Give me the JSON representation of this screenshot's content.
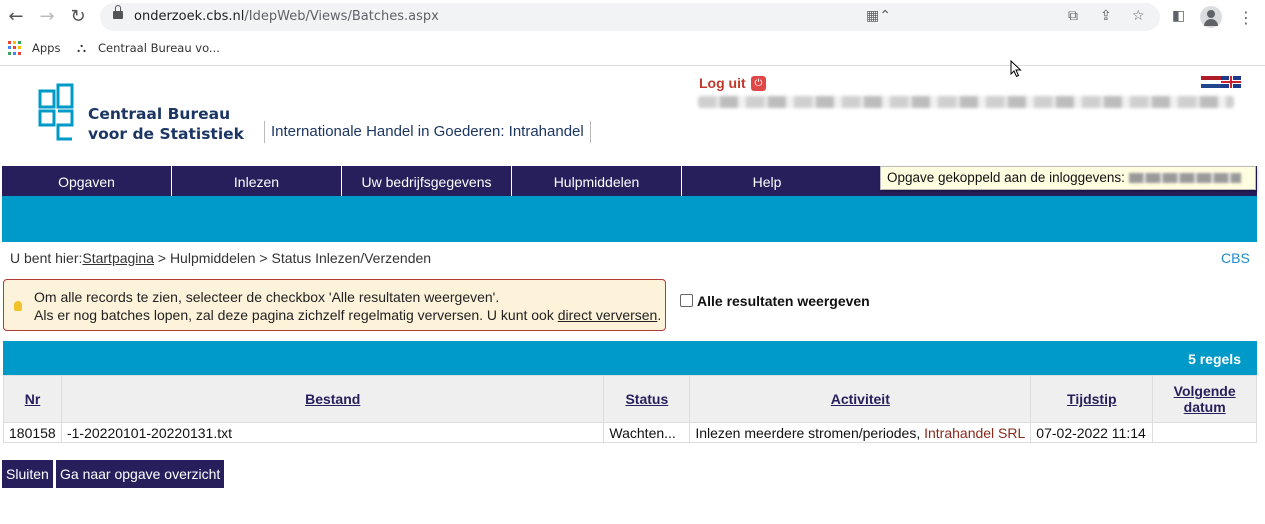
{
  "browser": {
    "url_host": "onderzoek.cbs.nl",
    "url_path": "/IdepWeb/Views/Batches.aspx",
    "bookmarks": [
      "Apps",
      "Centraal Bureau vo..."
    ]
  },
  "header": {
    "logo_line1": "Centraal Bureau",
    "logo_line2": "voor de Statistiek",
    "app_title": "Internationale Handel in Goederen: Intrahandel",
    "logout": "Log uit"
  },
  "menu": {
    "items": [
      "Opgaven",
      "Inlezen",
      "Uw bedrijfsgegevens",
      "Hulpmiddelen",
      "Help"
    ],
    "tooltip": "Opgave gekoppeld aan de inloggevens:"
  },
  "breadcrumb": {
    "prefix": "U bent hier:",
    "home": "Startpagina",
    "sep1": " > Hulpmiddelen > Status Inlezen/Verzenden",
    "cbs": "CBS"
  },
  "notice": {
    "line1": "Om alle records te zien, selecteer de checkbox 'Alle resultaten weergeven'.",
    "line2_pre": "Als er nog batches lopen, zal deze pagina zichzelf regelmatig verversen. U kunt ook ",
    "line2_link": "direct verversen",
    "line2_post": "."
  },
  "filter": {
    "label": "Alle resultaten weergeven",
    "checked": false
  },
  "table": {
    "count_label": "5 regels",
    "headers": {
      "nr": "Nr",
      "bestand": "Bestand",
      "status": "Status",
      "activiteit": "Activiteit",
      "tijdstip": "Tijdstip",
      "volgende": "Volgende datum"
    },
    "rows": [
      {
        "nr": "180158",
        "bestand": "-1-20220101-20220131.txt",
        "status": "Wachten...",
        "activiteit": "Inlezen meerdere stromen/periodes,",
        "product": "Intrahandel SRL",
        "tijdstip": "07-02-2022 11:14",
        "volgende": ""
      }
    ]
  },
  "buttons": {
    "close": "Sluiten",
    "overview": "Ga naar opgave overzicht"
  },
  "colors": {
    "nav": "#271f5c",
    "band": "#009ac9",
    "logout": "#c0392b"
  }
}
